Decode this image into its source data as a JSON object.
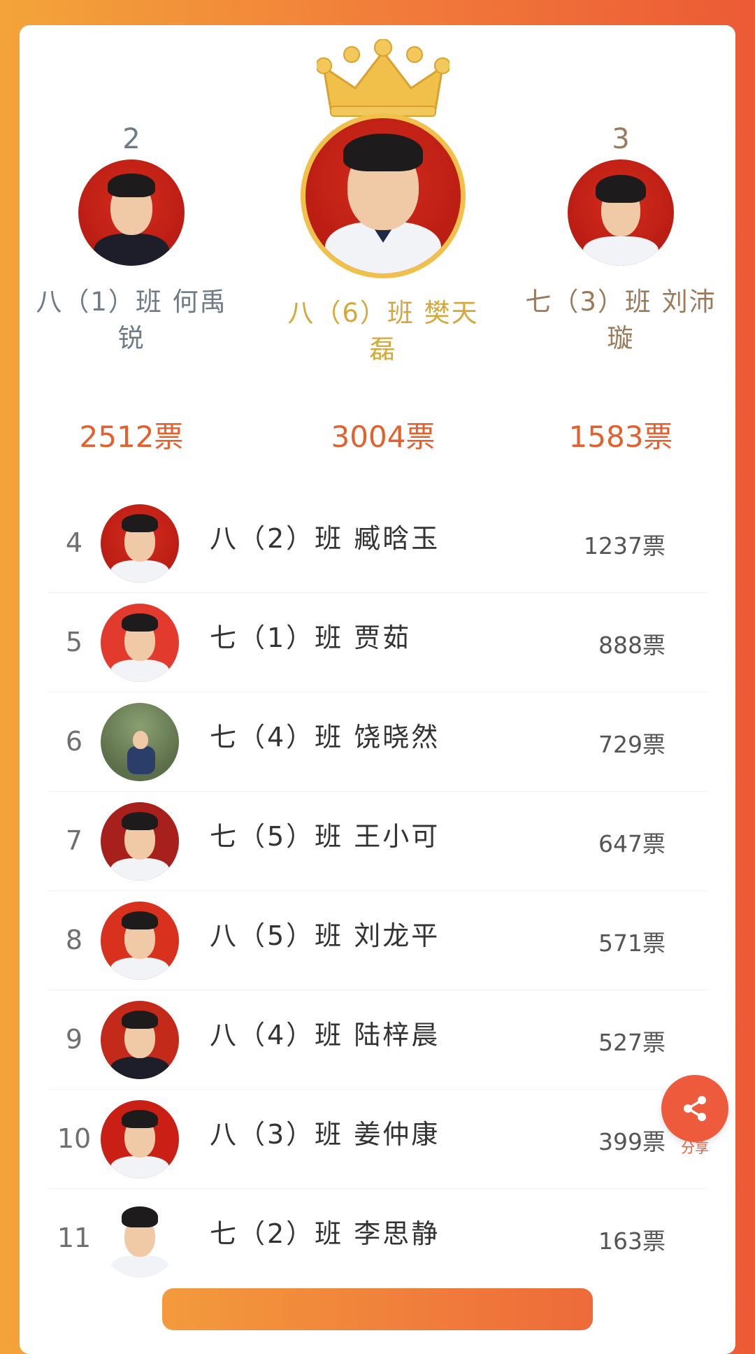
{
  "podium": {
    "second": {
      "rank": "2",
      "name": "八（1）班 何禹锐",
      "votes": "2512票"
    },
    "first": {
      "rank": "",
      "name": "八（6）班 樊天磊",
      "votes": "3004票"
    },
    "third": {
      "rank": "3",
      "name": "七（3）班 刘沛璇",
      "votes": "1583票"
    }
  },
  "list": [
    {
      "rank": "4",
      "name": "八（2）班 臧晗玉",
      "votes": "1237票"
    },
    {
      "rank": "5",
      "name": "七（1）班 贾茹",
      "votes": "888票"
    },
    {
      "rank": "6",
      "name": "七（4）班 饶晓然",
      "votes": "729票"
    },
    {
      "rank": "7",
      "name": "七（5）班 王小可",
      "votes": "647票"
    },
    {
      "rank": "8",
      "name": "八（5）班 刘龙平",
      "votes": "571票"
    },
    {
      "rank": "9",
      "name": "八（4）班 陆梓晨",
      "votes": "527票"
    },
    {
      "rank": "10",
      "name": "八（3）班 姜仲康",
      "votes": "399票"
    },
    {
      "rank": "11",
      "name": "七（2）班 李思静",
      "votes": "163票"
    }
  ],
  "share": {
    "label": "分享",
    "icon": "share-icon"
  },
  "colors": {
    "accent": "#ee5a3c",
    "gold": "#d4a83a",
    "votes": "#e4602d"
  }
}
